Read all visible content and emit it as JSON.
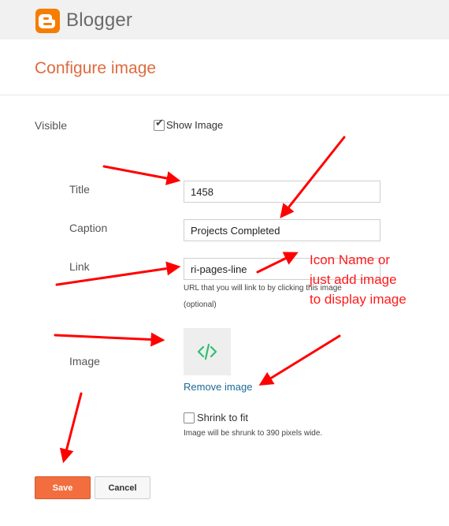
{
  "app": {
    "brand": "Blogger",
    "colors": {
      "brand": "#f57d00",
      "accent": "#dd6b3f",
      "link": "#1d6a96",
      "save": "#f36e3e",
      "annotation": "#ff1a1a"
    }
  },
  "page": {
    "title": "Configure image"
  },
  "form": {
    "visible_label": "Visible",
    "show_image_label": "Show Image",
    "show_image_checked": true,
    "title_label": "Title",
    "title_value": "1458",
    "caption_label": "Caption",
    "caption_value": "Projects Completed",
    "link_label": "Link",
    "link_value": "ri-pages-line",
    "link_hint": "URL that you will link to by clicking this image",
    "link_hint_optional": "(optional)",
    "image_label": "Image",
    "image_icon": "code-icon",
    "remove_image": "Remove image",
    "shrink_label": "Shrink to fit",
    "shrink_checked": false,
    "shrink_hint": "Image will be shrunk to 390 pixels wide."
  },
  "buttons": {
    "save": "Save",
    "cancel": "Cancel"
  },
  "annotation": {
    "line1": "Icon Name or",
    "line2": "just add image",
    "line3": "to display image"
  }
}
